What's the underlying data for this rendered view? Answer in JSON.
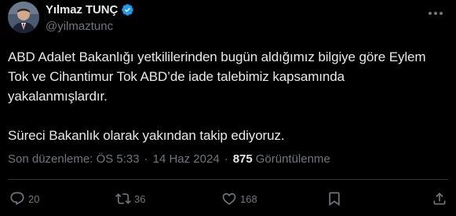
{
  "author": {
    "display_name": "Yılmaz TUNÇ",
    "handle": "@yilmaztunc",
    "verified_icon": "verified-badge-icon"
  },
  "post": {
    "paragraphs": [
      "ABD Adalet Bakanlığı yetkililerinden bugün aldığımız bilgiye göre Eylem Tok ve Cihantimur Tok ABD’de iade talebimiz kapsamında yakalanmışlardır.",
      "Süreci Bakanlık olarak yakından takip ediyoruz."
    ]
  },
  "meta": {
    "edited_label": "Son düzenleme: ÖS 5:33",
    "separator": "·",
    "date": "14 Haz 2024",
    "views_count": "875",
    "views_label": "Görüntülenme"
  },
  "actions": {
    "replies": "20",
    "reposts": "36",
    "likes": "168"
  },
  "colors": {
    "background": "#000000",
    "text": "#e7e9ea",
    "muted": "#71767b",
    "verified": "#1d9bf0",
    "divider": "#2f3336"
  }
}
